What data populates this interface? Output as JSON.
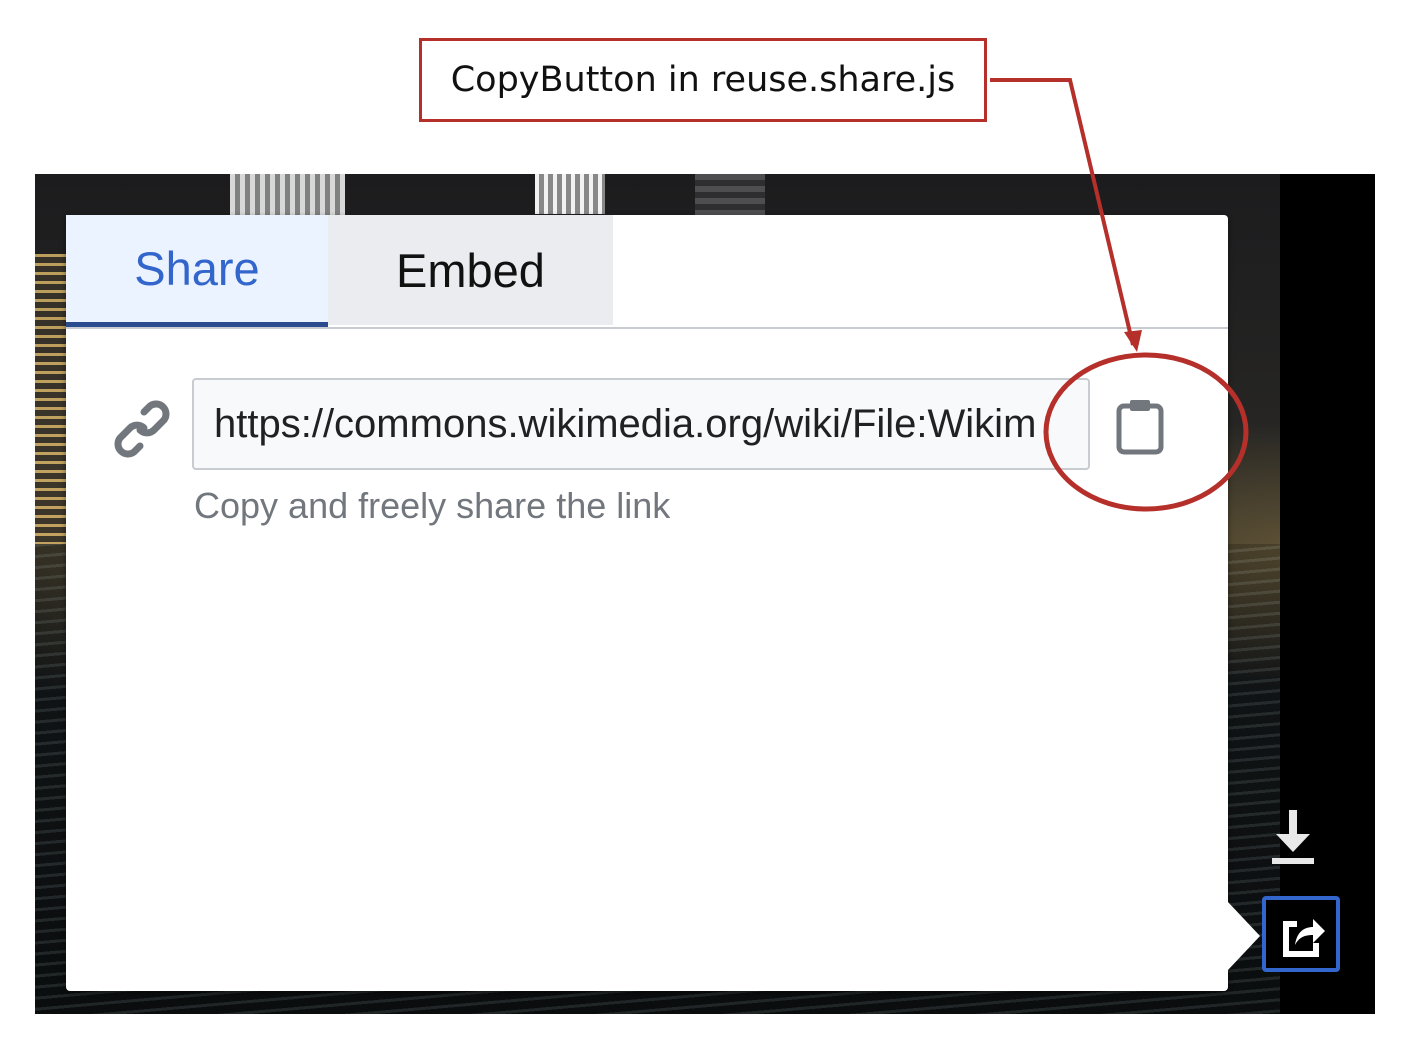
{
  "annotation": {
    "label": "CopyButton in reuse.share.js"
  },
  "tabs": {
    "share_label": "Share",
    "embed_label": "Embed"
  },
  "share_panel": {
    "url_value": "https://commons.wikimedia.org/wiki/File:Wikim",
    "hint": "Copy and freely share the link",
    "copy_icon": "clipboard-icon",
    "link_icon": "link-icon"
  },
  "side_controls": {
    "download_icon": "download-icon",
    "share_icon": "share-icon"
  },
  "colors": {
    "annotation": "#b5302a",
    "active_tab_text": "#3366cc",
    "active_tab_bg": "#eaf3ff",
    "active_tab_underline": "#2a4b8d",
    "inactive_tab_bg": "#eaecf0"
  }
}
